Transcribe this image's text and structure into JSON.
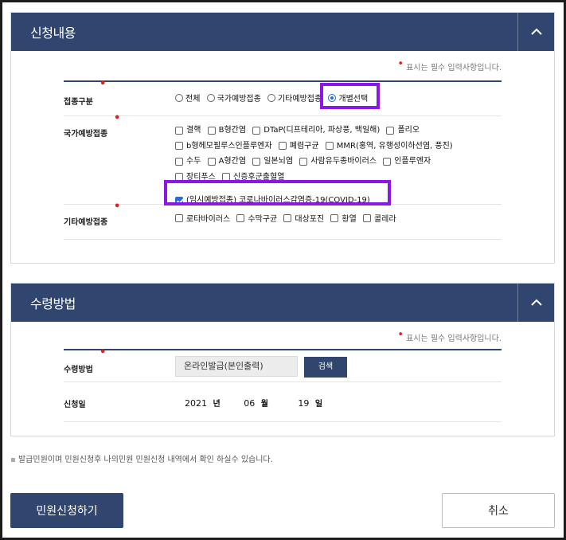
{
  "section1": {
    "title": "신청내용",
    "required_note": "표시는 필수 입력사항입니다.",
    "rows": {
      "type": {
        "label": "접종구분",
        "options": [
          "전체",
          "국가예방접종",
          "기타예방접종",
          "개별선택"
        ],
        "selected": "개별선택"
      },
      "national": {
        "label": "국가예방접종",
        "options": [
          "결핵",
          "B형간염",
          "DTaP(디프테리아, 파상풍, 백일해)",
          "폴리오",
          "b형헤모필루스인플루엔자",
          "폐렴구균",
          "MMR(홍역, 유행성이하선염, 풍진)",
          "수두",
          "A형간염",
          "일본뇌염",
          "사람유두종바이러스",
          "인플루엔자",
          "장티푸스",
          "신증후군출혈열"
        ],
        "covid": "(임시예방접종) 코로나바이러스감염증-19(COVID-19)",
        "covid_checked": true
      },
      "other": {
        "label": "기타예방접종",
        "options": [
          "로타바이러스",
          "수막구균",
          "대상포진",
          "황열",
          "콜레라"
        ]
      }
    }
  },
  "section2": {
    "title": "수령방법",
    "required_note": "표시는 필수 입력사항입니다.",
    "method_label": "수령방법",
    "method_value": "온라인발급(본인출력)",
    "search_label": "검색",
    "date_label": "신청일",
    "year": "2021",
    "year_unit": "년",
    "month": "06",
    "month_unit": "월",
    "day": "19",
    "day_unit": "일"
  },
  "notice": "발급민원이며 민원신청후 나의민원 민원신청 내역에서 확인 하실수 있습니다.",
  "buttons": {
    "apply": "민원신청하기",
    "cancel": "취소"
  },
  "colors": {
    "navy": "#31466e",
    "highlight": "#8a17e8",
    "required": "#e02020",
    "checked": "#1e6fd9"
  }
}
